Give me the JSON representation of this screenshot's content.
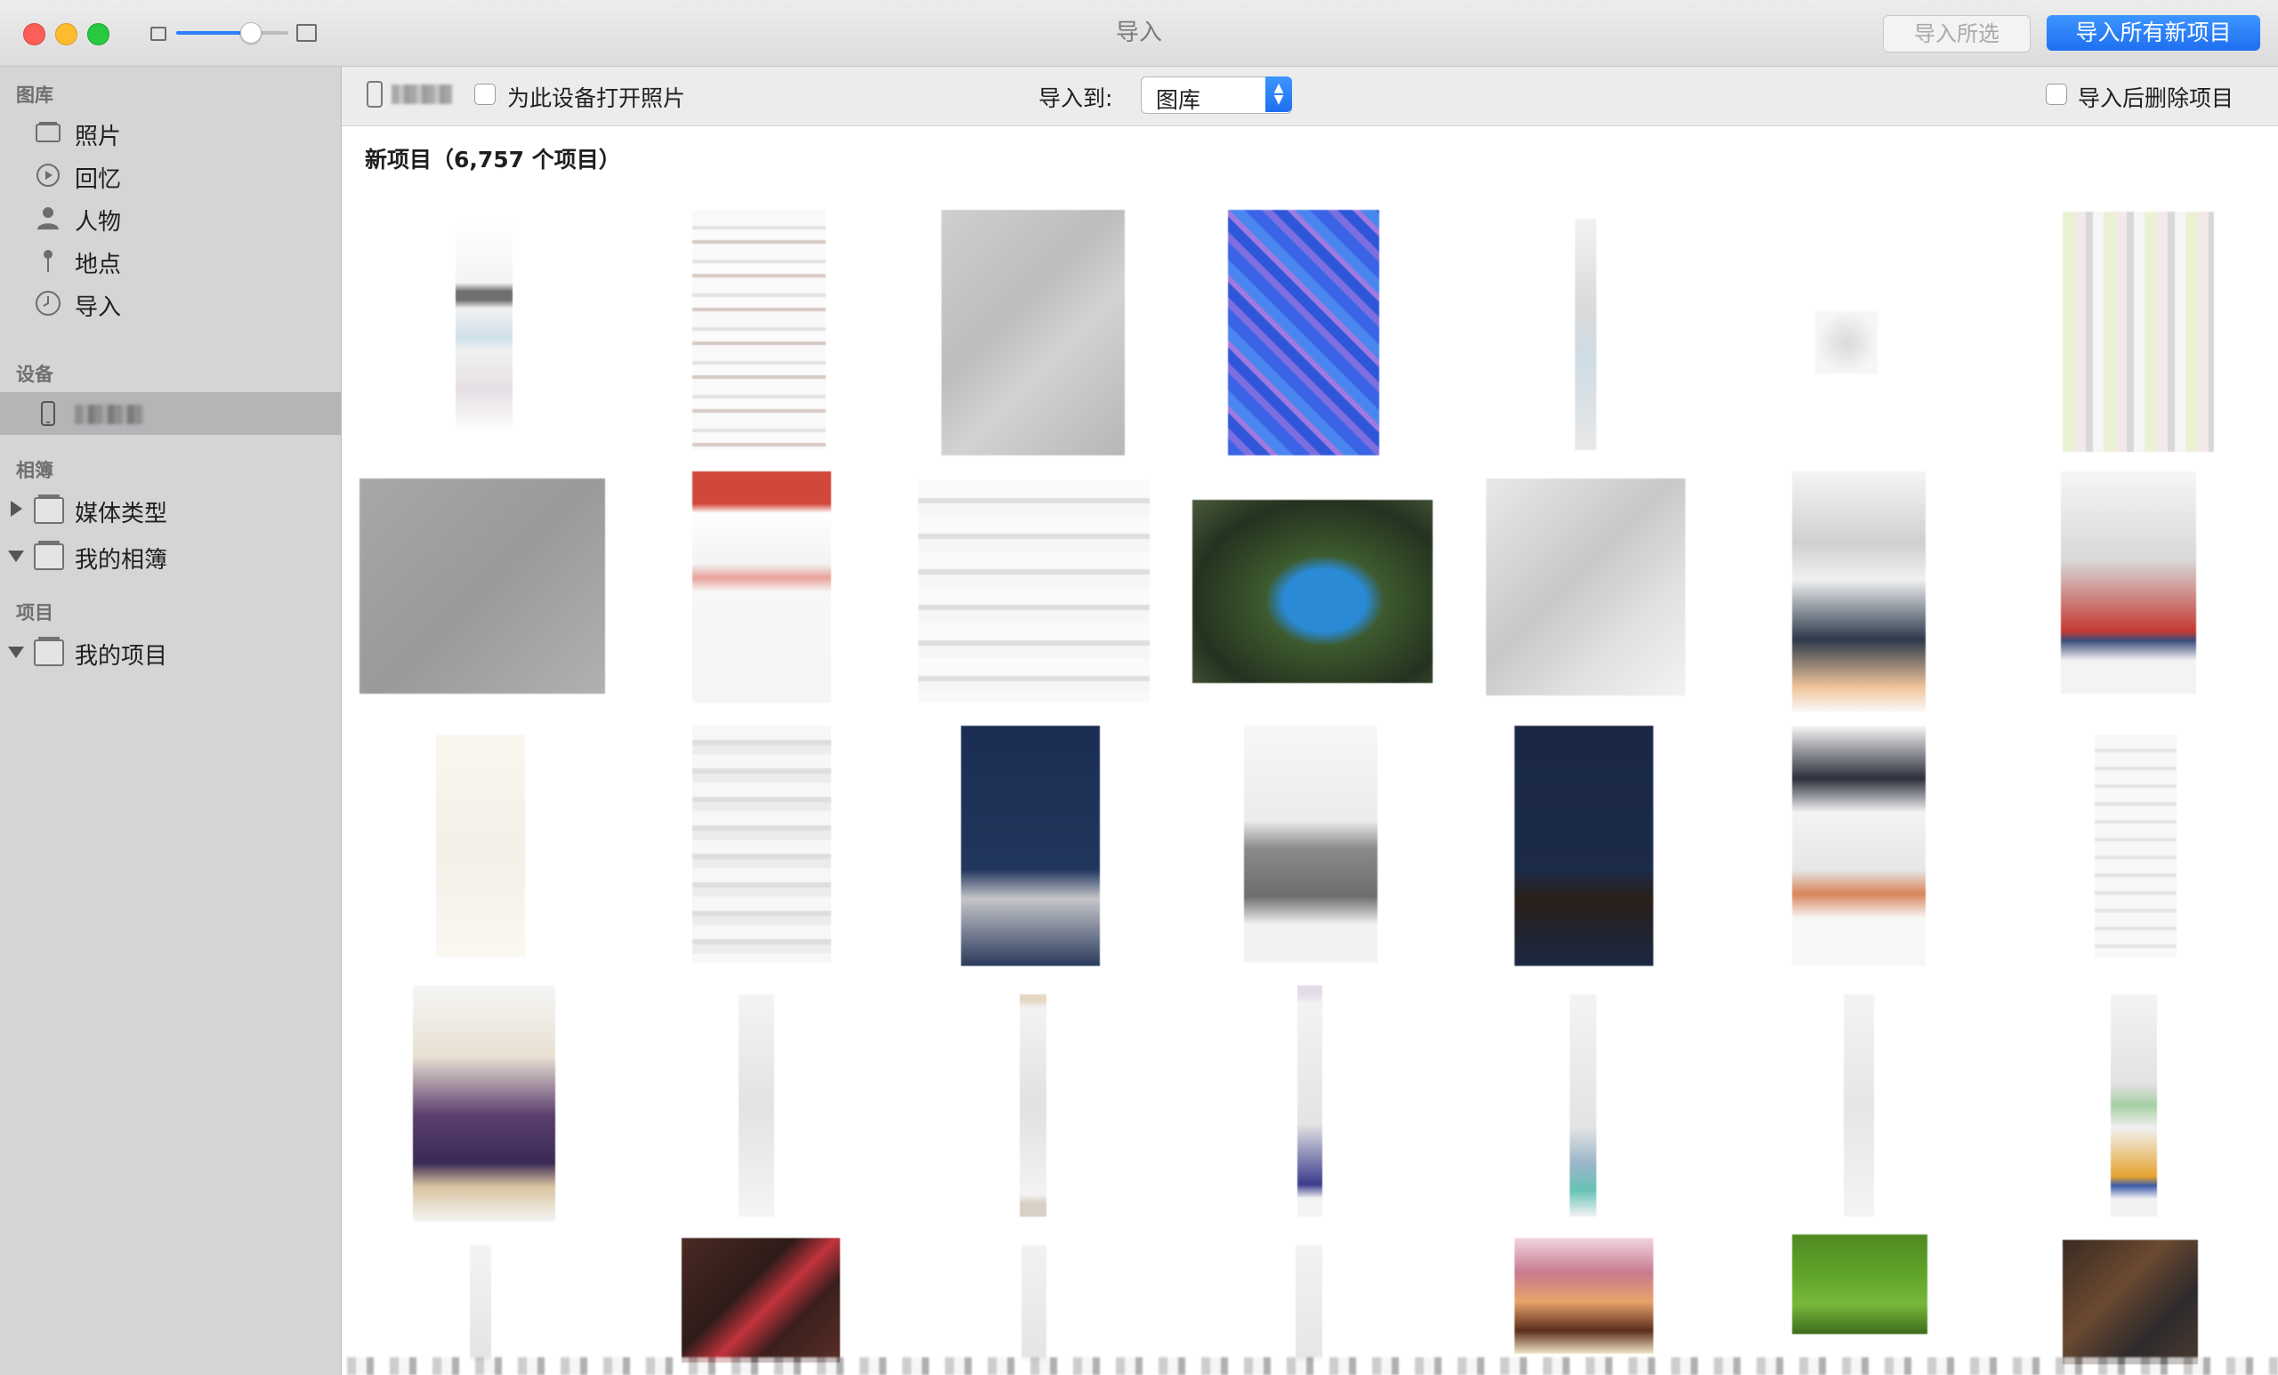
{
  "window": {
    "title": "导入"
  },
  "toolbar": {
    "import_selected": "导入所选",
    "import_all_new": "导入所有新项目",
    "open_photos_label": "为此设备打开照片",
    "import_to_label": "导入到:",
    "import_to_value": "图库",
    "delete_after_label": "导入后删除项目"
  },
  "sidebar": {
    "library_header": "图库",
    "library_items": [
      {
        "label": "照片",
        "icon": "photos-icon"
      },
      {
        "label": "回忆",
        "icon": "memories-icon"
      },
      {
        "label": "人物",
        "icon": "person-icon"
      },
      {
        "label": "地点",
        "icon": "pin-icon"
      },
      {
        "label": "导入",
        "icon": "clock-icon"
      }
    ],
    "devices_header": "设备",
    "albums_header": "相簿",
    "album_items": [
      {
        "label": "媒体类型",
        "expanded": false
      },
      {
        "label": "我的相簿",
        "expanded": true
      }
    ],
    "projects_header": "项目",
    "project_items": [
      {
        "label": "我的项目",
        "expanded": true
      }
    ]
  },
  "content": {
    "section_title": "新项目（6,757 个项目）"
  },
  "colors": {
    "accent": "#2d7ff9",
    "sidebar_bg": "#d5d5d8",
    "titlebar_bg": "#e4e4e4"
  }
}
